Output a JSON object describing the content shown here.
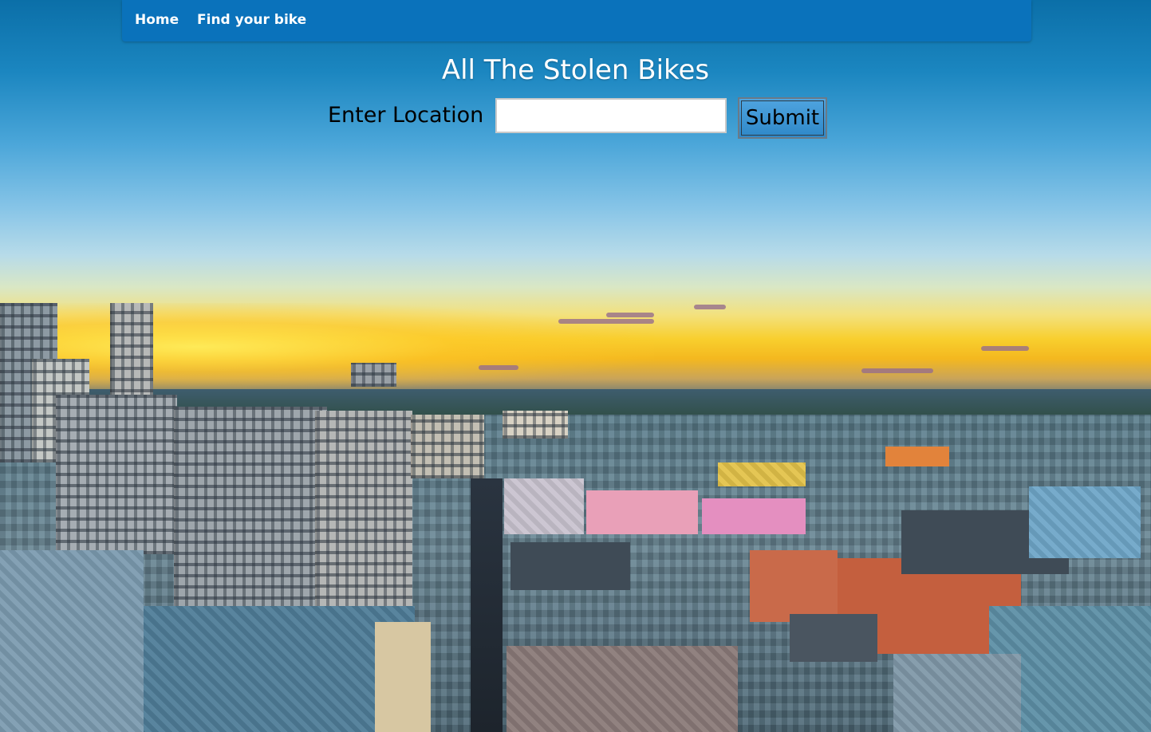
{
  "navbar": {
    "links": [
      {
        "label": "Home"
      },
      {
        "label": "Find your bike"
      }
    ],
    "color": "#0a72bb"
  },
  "main": {
    "title": "All The Stolen Bikes",
    "form": {
      "location_label": "Enter Location",
      "location_value": "",
      "submit_label": "Submit"
    }
  },
  "background": {
    "description_icon": "city-skyline-sunset-photo"
  }
}
